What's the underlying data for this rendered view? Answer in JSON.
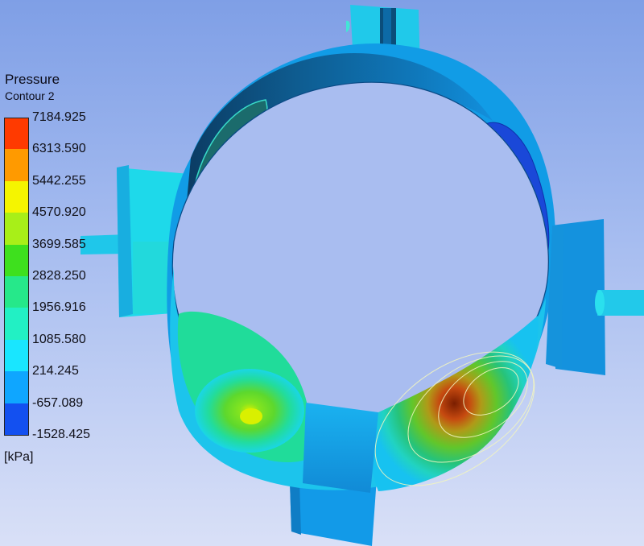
{
  "legend": {
    "title": "Pressure",
    "subtitle": "Contour 2",
    "unit": "[kPa]",
    "levels": [
      {
        "value": "7184.925",
        "color": "#ff3a00"
      },
      {
        "value": "6313.590",
        "color": "#ff9a00"
      },
      {
        "value": "5442.255",
        "color": "#f5f500"
      },
      {
        "value": "4570.920",
        "color": "#a8ef18"
      },
      {
        "value": "3699.585",
        "color": "#3ee01e"
      },
      {
        "value": "2828.250",
        "color": "#26e88a"
      },
      {
        "value": "1956.916",
        "color": "#22f0c4"
      },
      {
        "value": "1085.580",
        "color": "#19e6ff"
      },
      {
        "value": "214.245",
        "color": "#0fa6ff"
      },
      {
        "value": "-657.089",
        "color": "#1350f0"
      },
      {
        "value": "-1528.425",
        "color": null
      }
    ]
  },
  "colors": {
    "background_top": "#7f9fe6",
    "background_bottom": "#d9e0f7",
    "ring_outer": "#129be8",
    "ring_shadow": "#0c5585",
    "peak_red": "#8a2000",
    "low_blue": "#1a48d8"
  }
}
